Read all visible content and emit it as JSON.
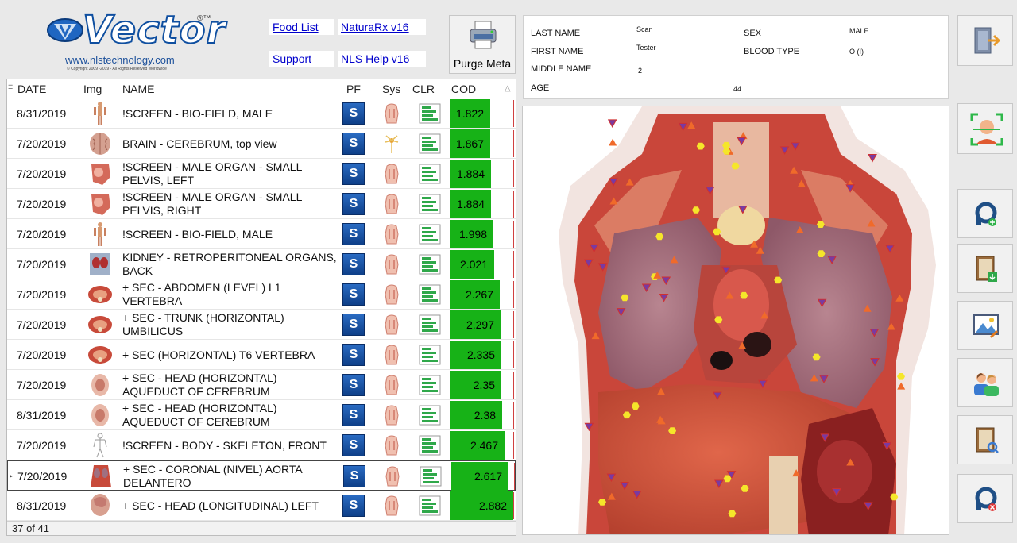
{
  "logo": {
    "word": "Vector",
    "registered": "®™",
    "url": "www.nlstechnology.com",
    "copyright": "© Copyright 2009 -2019 - All Rights Reserved Worldwide"
  },
  "links": {
    "food_list": "Food List",
    "naturarx": "NaturaRx v16",
    "support": "Support",
    "nls_help": "NLS Help v16"
  },
  "purge_meta": {
    "label": "Purge Meta"
  },
  "grid": {
    "columns": [
      "DATE",
      "Img",
      "NAME",
      "PF",
      "Sys",
      "CLR",
      "COD"
    ],
    "sort_indicator": "△",
    "pf_label": "S",
    "footer": "37 of 41",
    "rows": [
      {
        "date": "8/31/2019",
        "name": "!SCREEN - BIO-FIELD, MALE",
        "cod": "1.822",
        "cod_fill": 0.62,
        "thumb": "body"
      },
      {
        "date": "7/20/2019",
        "name": "BRAIN - CEREBRUM, top view",
        "cod": "1.867",
        "cod_fill": 0.63,
        "thumb": "brain"
      },
      {
        "date": "7/20/2019",
        "name": "!SCREEN - MALE ORGAN - SMALL PELVIS, LEFT",
        "cod": "1.884",
        "cod_fill": 0.64,
        "thumb": "organ"
      },
      {
        "date": "7/20/2019",
        "name": "!SCREEN - MALE ORGAN - SMALL PELVIS, RIGHT",
        "cod": "1.884",
        "cod_fill": 0.64,
        "thumb": "organ"
      },
      {
        "date": "7/20/2019",
        "name": "!SCREEN - BIO-FIELD, MALE",
        "cod": "1.998",
        "cod_fill": 0.68,
        "thumb": "body"
      },
      {
        "date": "7/20/2019",
        "name": "KIDNEY - RETROPERITONEAL ORGANS, BACK",
        "cod": "2.021",
        "cod_fill": 0.69,
        "thumb": "kidney"
      },
      {
        "date": "7/20/2019",
        "name": "+ SEC - ABDOMEN (LEVEL) L1 VERTEBRA",
        "cod": "2.267",
        "cod_fill": 0.78,
        "thumb": "section"
      },
      {
        "date": "7/20/2019",
        "name": "+ SEC - TRUNK (HORIZONTAL) UMBILICUS",
        "cod": "2.297",
        "cod_fill": 0.79,
        "thumb": "section"
      },
      {
        "date": "7/20/2019",
        "name": "+ SEC (HORIZONTAL) T6 VERTEBRA",
        "cod": "2.335",
        "cod_fill": 0.8,
        "thumb": "section"
      },
      {
        "date": "7/20/2019",
        "name": "+ SEC - HEAD (HORIZONTAL) AQUEDUCT OF CEREBRUM",
        "cod": "2.35",
        "cod_fill": 0.8,
        "thumb": "head"
      },
      {
        "date": "8/31/2019",
        "name": "+ SEC - HEAD (HORIZONTAL) AQUEDUCT OF CEREBRUM",
        "cod": "2.38",
        "cod_fill": 0.81,
        "thumb": "head"
      },
      {
        "date": "7/20/2019",
        "name": "!SCREEN - BODY - SKELETON, FRONT",
        "cod": "2.467",
        "cod_fill": 0.85,
        "thumb": "skeleton"
      },
      {
        "date": "7/20/2019",
        "name": "+ SEC - CORONAL (NIVEL) AORTA DELANTERO",
        "cod": "2.617",
        "cod_fill": 0.9,
        "thumb": "torso",
        "current": true
      },
      {
        "date": "8/31/2019",
        "name": "+ SEC - HEAD (LONGITUDINAL) LEFT",
        "cod": "2.882",
        "cod_fill": 0.99,
        "thumb": "headlong"
      }
    ]
  },
  "patient": {
    "last_name_label": "LAST NAME",
    "last_name": "Scan",
    "first_name_label": "FIRST NAME",
    "first_name": "Tester",
    "middle_name_label": "MIDDLE NAME",
    "middle_name": "2",
    "age_label": "AGE",
    "age": "44",
    "sex_label": "SEX",
    "sex": "MALE",
    "blood_label": "BLOOD TYPE",
    "blood": "O (I)"
  },
  "colors": {
    "cod_green": "#17b217",
    "pf_blue": "#1a56a8",
    "link": "#0000cc"
  },
  "right_toolbar": [
    "exit-icon",
    "face-scan-icon",
    "add-user-icon",
    "save-book-icon",
    "image-edit-icon",
    "users-icon",
    "search-book-icon",
    "remove-user-icon"
  ]
}
